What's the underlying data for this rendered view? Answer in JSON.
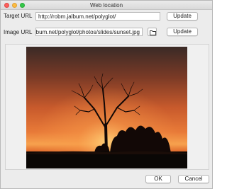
{
  "window": {
    "title": "Web location"
  },
  "target_url": {
    "label": "Target URL",
    "value": "http://robm.jalbum.net/polyglot/",
    "update_label": "Update"
  },
  "image_url": {
    "label": "Image URL",
    "value": "http://robm.jalbum.net/polyglot/photos/slides/sunset.jpg",
    "update_label": "Update",
    "browse_icon": "folder-icon"
  },
  "preview": {
    "subject": "sunset-tree-silhouette"
  },
  "footer": {
    "ok_label": "OK",
    "cancel_label": "Cancel"
  },
  "colors": {
    "sky_top": "#3a2a26",
    "sky_mid": "#e46a34",
    "sky_glow": "#f7a24e",
    "ground": "#0a0705"
  }
}
